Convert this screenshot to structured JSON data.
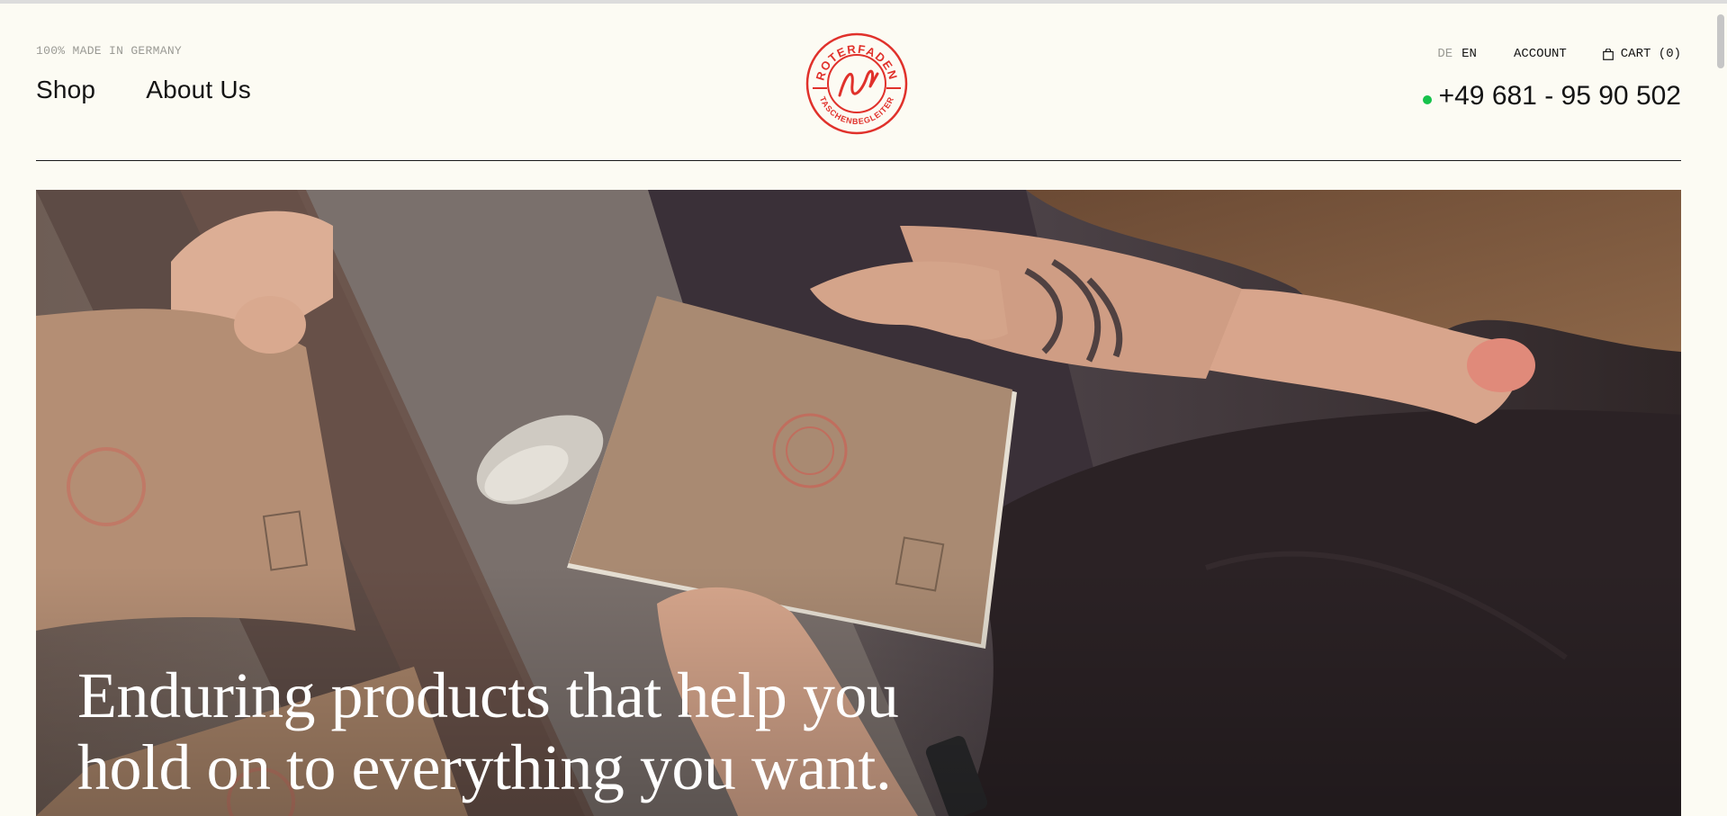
{
  "header": {
    "tagline": "100% MADE IN GERMANY",
    "nav": [
      {
        "label": "Shop"
      },
      {
        "label": "About Us"
      }
    ],
    "logo": {
      "top_text": "ROTERFADEN",
      "bottom_text": "TASCHENBEGLEITER",
      "color": "#e0312b"
    },
    "utility": {
      "lang_de": "DE",
      "lang_en": "EN",
      "account": "ACCOUNT",
      "cart": "CART (0)"
    },
    "phone": "+49 681 - 95 90 502",
    "status_color": "#16c24b"
  },
  "hero": {
    "headline_line1": "Enduring products that help you",
    "headline_line2": "hold on to everything you want."
  }
}
